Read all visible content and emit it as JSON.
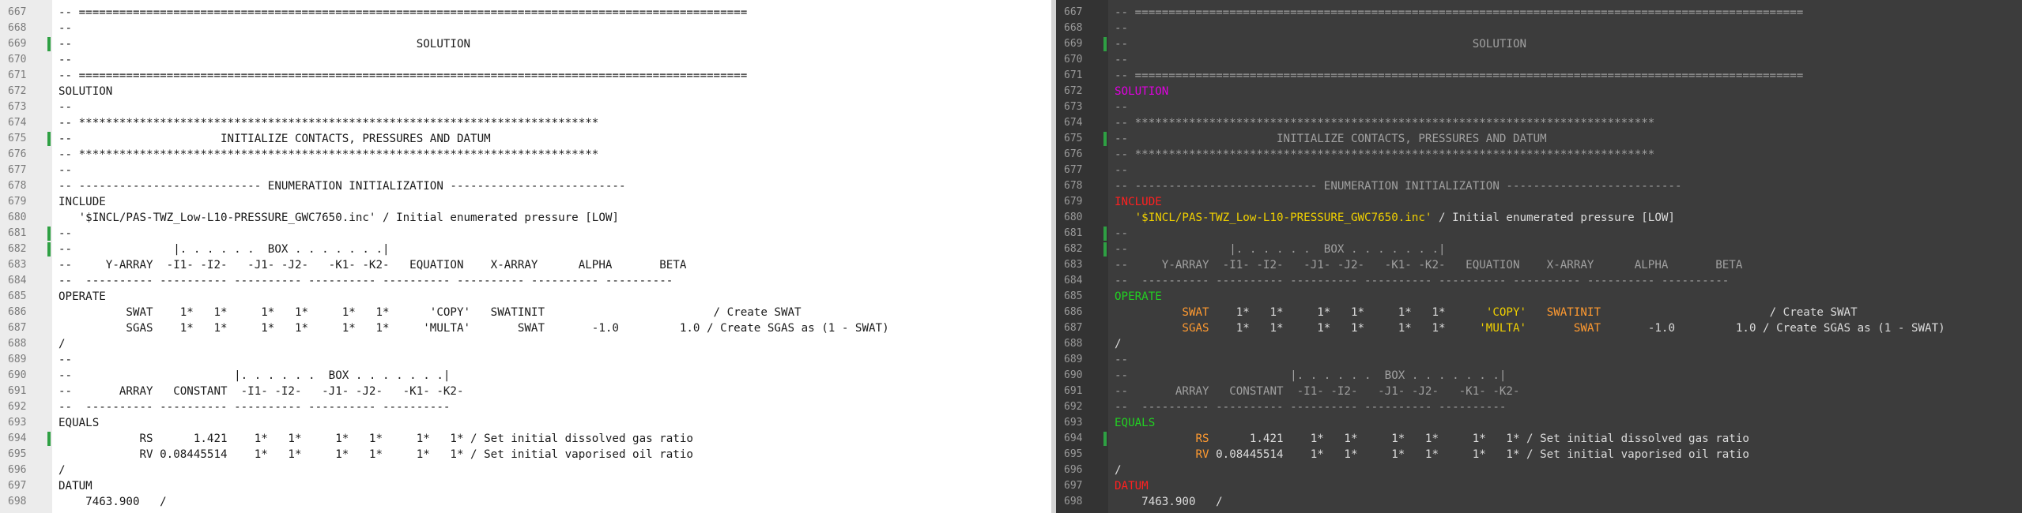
{
  "colors": {
    "left_background": "#ffffff",
    "right_background": "#3c3c3c",
    "change_marker": "#2ea043",
    "right_comment": "#a0a0a0",
    "right_section_keyword": "#e000e0",
    "right_keyword_red": "#ff2020",
    "right_keyword_green": "#22d022",
    "right_string": "#f0d000",
    "right_variable": "#ff9a30"
  },
  "left_pane": {
    "lines": [
      {
        "num": "667",
        "changed": false,
        "text": "-- ==================================================================================================="
      },
      {
        "num": "668",
        "changed": false,
        "text": "--"
      },
      {
        "num": "669",
        "changed": true,
        "text": "--                                                   SOLUTION"
      },
      {
        "num": "670",
        "changed": false,
        "text": "--"
      },
      {
        "num": "671",
        "changed": false,
        "text": "-- ==================================================================================================="
      },
      {
        "num": "672",
        "changed": false,
        "text": "SOLUTION"
      },
      {
        "num": "673",
        "changed": false,
        "text": "--"
      },
      {
        "num": "674",
        "changed": false,
        "text": "-- *****************************************************************************"
      },
      {
        "num": "675",
        "changed": true,
        "text": "--                      INITIALIZE CONTACTS, PRESSURES AND DATUM"
      },
      {
        "num": "676",
        "changed": false,
        "text": "-- *****************************************************************************"
      },
      {
        "num": "677",
        "changed": false,
        "text": "--"
      },
      {
        "num": "678",
        "changed": false,
        "text": "-- --------------------------- ENUMERATION INITIALIZATION --------------------------"
      },
      {
        "num": "679",
        "changed": false,
        "text": "INCLUDE"
      },
      {
        "num": "680",
        "changed": false,
        "text": "   '$INCL/PAS-TWZ_Low-L10-PRESSURE_GWC7650.inc' / Initial enumerated pressure [LOW]"
      },
      {
        "num": "681",
        "changed": true,
        "text": "--"
      },
      {
        "num": "682",
        "changed": true,
        "text": "--               |. . . . . .  BOX . . . . . . .|"
      },
      {
        "num": "683",
        "changed": false,
        "text": "--     Y-ARRAY  -I1- -I2-   -J1- -J2-   -K1- -K2-   EQUATION    X-ARRAY      ALPHA       BETA"
      },
      {
        "num": "684",
        "changed": false,
        "text": "--  ---------- ---------- ---------- ---------- ---------- ---------- ---------- ----------"
      },
      {
        "num": "685",
        "changed": false,
        "text": "OPERATE"
      },
      {
        "num": "686",
        "changed": false,
        "text": "          SWAT    1*   1*     1*   1*     1*   1*      'COPY'   SWATINIT                         / Create SWAT"
      },
      {
        "num": "687",
        "changed": false,
        "text": "          SGAS    1*   1*     1*   1*     1*   1*     'MULTA'       SWAT       -1.0         1.0 / Create SGAS as (1 - SWAT)"
      },
      {
        "num": "688",
        "changed": false,
        "text": "/"
      },
      {
        "num": "689",
        "changed": false,
        "text": "--"
      },
      {
        "num": "690",
        "changed": false,
        "text": "--                        |. . . . . .  BOX . . . . . . .|"
      },
      {
        "num": "691",
        "changed": false,
        "text": "--       ARRAY   CONSTANT  -I1- -I2-   -J1- -J2-   -K1- -K2-"
      },
      {
        "num": "692",
        "changed": false,
        "text": "--  ---------- ---------- ---------- ---------- ----------"
      },
      {
        "num": "693",
        "changed": false,
        "text": "EQUALS"
      },
      {
        "num": "694",
        "changed": true,
        "text": "            RS      1.421    1*   1*     1*   1*     1*   1* / Set initial dissolved gas ratio"
      },
      {
        "num": "695",
        "changed": false,
        "text": "            RV 0.08445514    1*   1*     1*   1*     1*   1* / Set initial vaporised oil ratio"
      },
      {
        "num": "696",
        "changed": false,
        "text": "/"
      },
      {
        "num": "697",
        "changed": false,
        "text": "DATUM"
      },
      {
        "num": "698",
        "changed": false,
        "text": "    7463.900   /"
      }
    ]
  },
  "right_pane": {
    "lines": [
      {
        "num": "667",
        "changed": false,
        "tokens": [
          {
            "t": "-- ===================================================================================================",
            "c": "c-comment"
          }
        ]
      },
      {
        "num": "668",
        "changed": false,
        "tokens": [
          {
            "t": "--",
            "c": "c-comment"
          }
        ]
      },
      {
        "num": "669",
        "changed": true,
        "tokens": [
          {
            "t": "--                                                   SOLUTION",
            "c": "c-comment"
          }
        ]
      },
      {
        "num": "670",
        "changed": false,
        "tokens": [
          {
            "t": "--",
            "c": "c-comment"
          }
        ]
      },
      {
        "num": "671",
        "changed": false,
        "tokens": [
          {
            "t": "-- ===================================================================================================",
            "c": "c-comment"
          }
        ]
      },
      {
        "num": "672",
        "changed": false,
        "tokens": [
          {
            "t": "SOLUTION",
            "c": "c-magenta"
          }
        ]
      },
      {
        "num": "673",
        "changed": false,
        "tokens": [
          {
            "t": "--",
            "c": "c-comment"
          }
        ]
      },
      {
        "num": "674",
        "changed": false,
        "tokens": [
          {
            "t": "-- *****************************************************************************",
            "c": "c-comment"
          }
        ]
      },
      {
        "num": "675",
        "changed": true,
        "tokens": [
          {
            "t": "--                      INITIALIZE CONTACTS, PRESSURES AND DATUM",
            "c": "c-comment"
          }
        ]
      },
      {
        "num": "676",
        "changed": false,
        "tokens": [
          {
            "t": "-- *****************************************************************************",
            "c": "c-comment"
          }
        ]
      },
      {
        "num": "677",
        "changed": false,
        "tokens": [
          {
            "t": "--",
            "c": "c-comment"
          }
        ]
      },
      {
        "num": "678",
        "changed": false,
        "tokens": [
          {
            "t": "-- --------------------------- ENUMERATION INITIALIZATION --------------------------",
            "c": "c-comment"
          }
        ]
      },
      {
        "num": "679",
        "changed": false,
        "tokens": [
          {
            "t": "INCLUDE",
            "c": "c-keyword"
          }
        ]
      },
      {
        "num": "680",
        "changed": false,
        "tokens": [
          {
            "t": "   ",
            "c": "c-plain"
          },
          {
            "t": "'$INCL/PAS-TWZ_Low-L10-PRESSURE_GWC7650.inc'",
            "c": "c-string"
          },
          {
            "t": " / Initial enumerated pressure [LOW]",
            "c": "c-plain"
          }
        ]
      },
      {
        "num": "681",
        "changed": true,
        "tokens": [
          {
            "t": "--",
            "c": "c-comment"
          }
        ]
      },
      {
        "num": "682",
        "changed": true,
        "tokens": [
          {
            "t": "--               |. . . . . .  BOX . . . . . . .|",
            "c": "c-comment"
          }
        ]
      },
      {
        "num": "683",
        "changed": false,
        "tokens": [
          {
            "t": "--     Y-ARRAY  -I1- -I2-   -J1- -J2-   -K1- -K2-   EQUATION    X-ARRAY      ALPHA       BETA",
            "c": "c-comment"
          }
        ]
      },
      {
        "num": "684",
        "changed": false,
        "tokens": [
          {
            "t": "--  ---------- ---------- ---------- ---------- ---------- ---------- ---------- ----------",
            "c": "c-comment"
          }
        ]
      },
      {
        "num": "685",
        "changed": false,
        "tokens": [
          {
            "t": "OPERATE",
            "c": "c-green"
          }
        ]
      },
      {
        "num": "686",
        "changed": false,
        "tokens": [
          {
            "t": "          ",
            "c": "c-plain"
          },
          {
            "t": "SWAT",
            "c": "c-orange"
          },
          {
            "t": "    1*   1*     1*   1*     1*   1*      ",
            "c": "c-plain"
          },
          {
            "t": "'COPY'",
            "c": "c-string"
          },
          {
            "t": "   ",
            "c": "c-plain"
          },
          {
            "t": "SWATINIT",
            "c": "c-orange"
          },
          {
            "t": "                         / Create SWAT",
            "c": "c-plain"
          }
        ]
      },
      {
        "num": "687",
        "changed": false,
        "tokens": [
          {
            "t": "          ",
            "c": "c-plain"
          },
          {
            "t": "SGAS",
            "c": "c-orange"
          },
          {
            "t": "    1*   1*     1*   1*     1*   1*     ",
            "c": "c-plain"
          },
          {
            "t": "'MULTA'",
            "c": "c-string"
          },
          {
            "t": "       ",
            "c": "c-plain"
          },
          {
            "t": "SWAT",
            "c": "c-orange"
          },
          {
            "t": "       -1.0         1.0 / Create SGAS as (1 - SWAT)",
            "c": "c-plain"
          }
        ]
      },
      {
        "num": "688",
        "changed": false,
        "tokens": [
          {
            "t": "/",
            "c": "c-plain"
          }
        ]
      },
      {
        "num": "689",
        "changed": false,
        "tokens": [
          {
            "t": "--",
            "c": "c-comment"
          }
        ]
      },
      {
        "num": "690",
        "changed": false,
        "tokens": [
          {
            "t": "--                        |. . . . . .  BOX . . . . . . .|",
            "c": "c-comment"
          }
        ]
      },
      {
        "num": "691",
        "changed": false,
        "tokens": [
          {
            "t": "--       ARRAY   CONSTANT  -I1- -I2-   -J1- -J2-   -K1- -K2-",
            "c": "c-comment"
          }
        ]
      },
      {
        "num": "692",
        "changed": false,
        "tokens": [
          {
            "t": "--  ---------- ---------- ---------- ---------- ----------",
            "c": "c-comment"
          }
        ]
      },
      {
        "num": "693",
        "changed": false,
        "tokens": [
          {
            "t": "EQUALS",
            "c": "c-green"
          }
        ]
      },
      {
        "num": "694",
        "changed": true,
        "tokens": [
          {
            "t": "            ",
            "c": "c-plain"
          },
          {
            "t": "RS",
            "c": "c-orange"
          },
          {
            "t": "      1.421    1*   1*     1*   1*     1*   1* / Set initial dissolved gas ratio",
            "c": "c-plain"
          }
        ]
      },
      {
        "num": "695",
        "changed": false,
        "tokens": [
          {
            "t": "            ",
            "c": "c-plain"
          },
          {
            "t": "RV",
            "c": "c-orange"
          },
          {
            "t": " 0.08445514    1*   1*     1*   1*     1*   1* / Set initial vaporised oil ratio",
            "c": "c-plain"
          }
        ]
      },
      {
        "num": "696",
        "changed": false,
        "tokens": [
          {
            "t": "/",
            "c": "c-plain"
          }
        ]
      },
      {
        "num": "697",
        "changed": false,
        "tokens": [
          {
            "t": "DATUM",
            "c": "c-keyword"
          }
        ]
      },
      {
        "num": "698",
        "changed": false,
        "tokens": [
          {
            "t": "    7463.900   /",
            "c": "c-plain"
          }
        ]
      }
    ]
  }
}
